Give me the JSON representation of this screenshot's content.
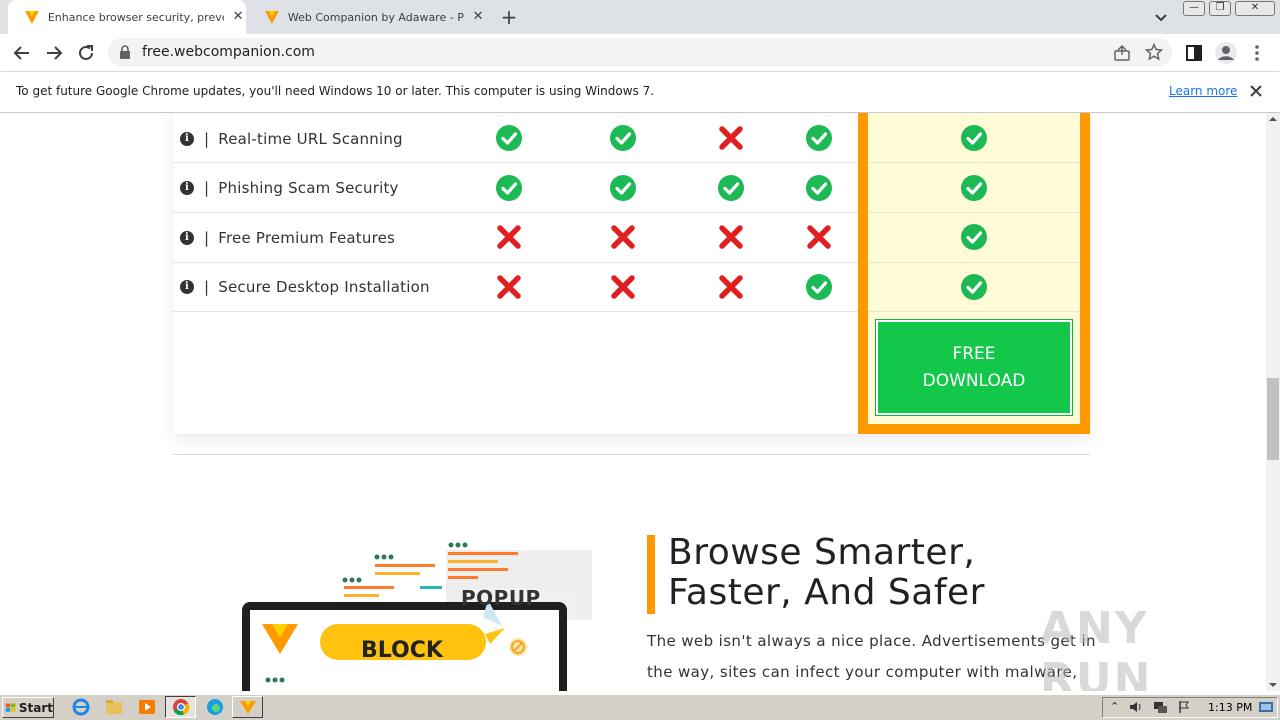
{
  "browser": {
    "tabs": [
      {
        "title": "Enhance browser security, prevent m",
        "active": true
      },
      {
        "title": "Web Companion by Adaware - Preve",
        "active": false
      }
    ],
    "new_tab": "+",
    "url": "free.webcompanion.com",
    "infobar": {
      "message": "To get future Google Chrome updates, you'll need Windows 10 or later. This computer is using Windows 7.",
      "link": "Learn more"
    }
  },
  "comparison": {
    "rows": [
      {
        "label": "Real-time URL Scanning",
        "cols": [
          "check",
          "check",
          "cross",
          "check"
        ],
        "premium": "check"
      },
      {
        "label": "Phishing Scam Security",
        "cols": [
          "check",
          "check",
          "check",
          "check"
        ],
        "premium": "check"
      },
      {
        "label": "Free Premium Features",
        "cols": [
          "cross",
          "cross",
          "cross",
          "cross"
        ],
        "premium": "check"
      },
      {
        "label": "Secure Desktop Installation",
        "cols": [
          "cross",
          "cross",
          "cross",
          "check"
        ],
        "premium": "check"
      }
    ],
    "separator": "|",
    "download_line1": "FREE",
    "download_line2": "DOWNLOAD"
  },
  "section": {
    "heading_line1": "Browse Smarter,",
    "heading_line2": "Faster, And Safer",
    "paragraph_line1": "The web isn't always a nice place. Advertisements get in",
    "paragraph_line2": "the way, sites can infect your computer with malware,"
  },
  "illustration": {
    "popup_label": "POPUP",
    "block_label": "BLOCK"
  },
  "watermark": "ANY RUN",
  "taskbar": {
    "start_label": "Start",
    "clock": "1:13 PM"
  },
  "colors": {
    "accent_orange": "#ff9900",
    "download_green": "#12c74a",
    "check_green": "#1db954",
    "cross_red": "#e02020",
    "premium_bg": "#fffbd6"
  }
}
